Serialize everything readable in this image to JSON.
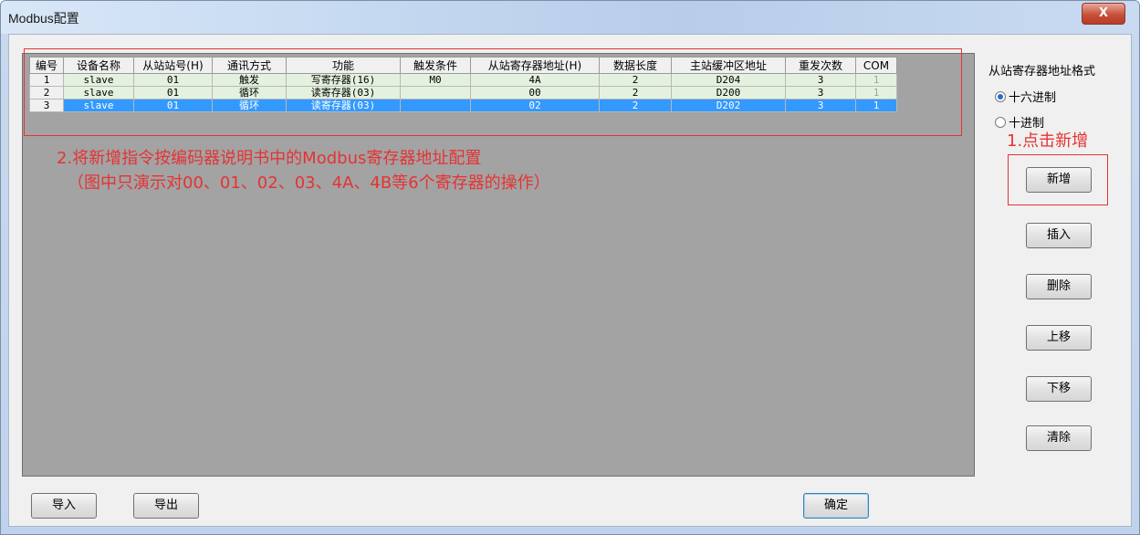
{
  "window": {
    "title": "Modbus配置",
    "close_label": "X"
  },
  "table": {
    "columns": [
      "编号",
      "设备名称",
      "从站站号(H)",
      "通讯方式",
      "功能",
      "触发条件",
      "从站寄存器地址(H)",
      "数据长度",
      "主站缓冲区地址",
      "重发次数",
      "COM"
    ],
    "rows": [
      {
        "no": "1",
        "device": "slave",
        "station": "01",
        "mode": "触发",
        "func": "写寄存器(16)",
        "trigger": "M0",
        "addr": "4A",
        "len": "2",
        "buf": "D204",
        "retry": "3",
        "com": "1",
        "selected": false
      },
      {
        "no": "2",
        "device": "slave",
        "station": "01",
        "mode": "循环",
        "func": "读寄存器(03)",
        "trigger": "",
        "addr": "00",
        "len": "2",
        "buf": "D200",
        "retry": "3",
        "com": "1",
        "selected": false
      },
      {
        "no": "3",
        "device": "slave",
        "station": "01",
        "mode": "循环",
        "func": "读寄存器(03)",
        "trigger": "",
        "addr": "02",
        "len": "2",
        "buf": "D202",
        "retry": "3",
        "com": "1",
        "selected": true
      }
    ]
  },
  "annotations": {
    "step2_line1": "2.将新增指令按编码器说明书中的Modbus寄存器地址配置",
    "step2_line2": "（图中只演示对00、01、02、03、4A、4B等6个寄存器的操作）",
    "step1": "1.点击新增"
  },
  "format_group": {
    "label": "从站寄存器地址格式",
    "options": [
      {
        "label": "十六进制",
        "checked": true
      },
      {
        "label": "十进制",
        "checked": false
      }
    ]
  },
  "buttons": {
    "add": "新增",
    "insert": "插入",
    "delete": "删除",
    "move_up": "上移",
    "move_down": "下移",
    "clear": "清除",
    "import": "导入",
    "export": "导出",
    "ok": "确定"
  },
  "colors": {
    "annotation_red": "#e53333",
    "selected_row": "#3399ff",
    "row_bg": "#e4f1de"
  }
}
